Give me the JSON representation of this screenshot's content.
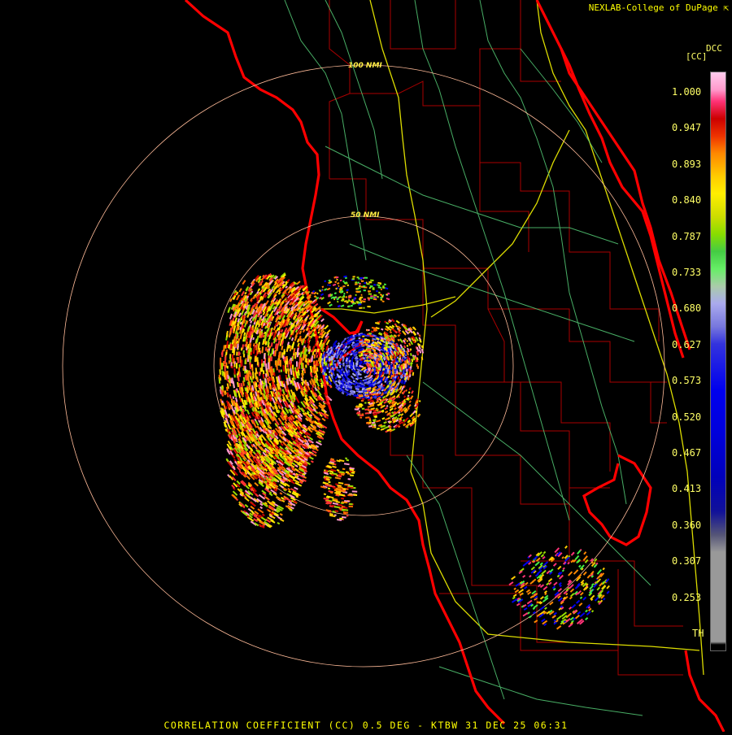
{
  "brand": "NEXLAB-College of DuPage",
  "legend": {
    "title_top": "DCC",
    "title_unit": "[CC]",
    "ticks": [
      "1.000",
      "0.947",
      "0.893",
      "0.840",
      "0.787",
      "0.733",
      "0.680",
      "0.627",
      "0.573",
      "0.520",
      "0.467",
      "0.413",
      "0.360",
      "0.307",
      "0.253",
      "TH"
    ],
    "colors": {
      "pink_high": "#ff99cc",
      "magenta": "#ff3377",
      "red": "#cc0000",
      "orange": "#ff8800",
      "yellow": "#ffdd00",
      "lime": "#99dd00",
      "green": "#44ee44",
      "lavender": "#9999dd",
      "blue": "#1111cc",
      "gray": "#999999"
    }
  },
  "range_rings": {
    "inner_label": "50 NMI",
    "outer_label": "100 NMI"
  },
  "footer": "CORRELATION COEFFICIENT (CC) 0.5 DEG - KTBW 31 DEC 25 06:31",
  "colors": {
    "background": "#000000",
    "coastline": "#ff0000",
    "county_lines": "#aa0000",
    "highways": "#ffff00",
    "roads": "#66dd88",
    "range_ring": "#ffbb99",
    "text": "#ffff00"
  }
}
